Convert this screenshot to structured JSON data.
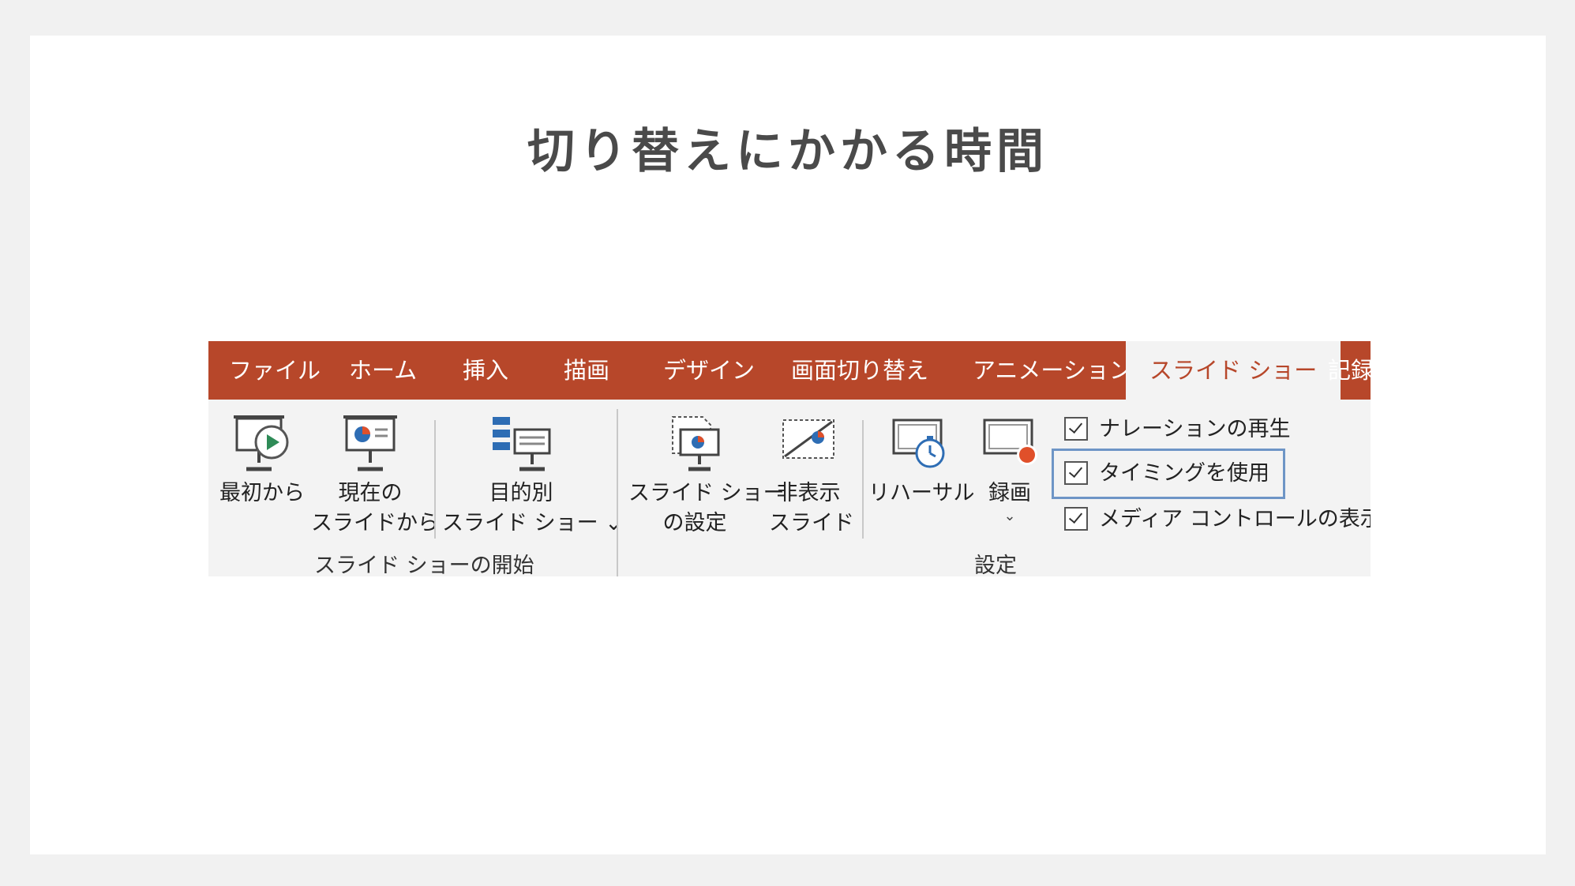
{
  "slide": {
    "title": "切り替えにかかる時間"
  },
  "ribbon": {
    "tabs": [
      {
        "label": "ファイル"
      },
      {
        "label": "ホーム"
      },
      {
        "label": "挿入"
      },
      {
        "label": "描画"
      },
      {
        "label": "デザイン"
      },
      {
        "label": "画面切り替え"
      },
      {
        "label": "アニメーション"
      },
      {
        "label": "スライド ショー"
      },
      {
        "label": "記録"
      }
    ],
    "active_tab": "スライド ショー",
    "groups": {
      "start": {
        "label": "スライド ショーの開始",
        "buttons": {
          "from_beginning": {
            "line1": "最初から"
          },
          "from_current": {
            "line1": "現在の",
            "line2": "スライドから"
          },
          "custom": {
            "line1": "目的別",
            "line2": "スライド ショー ⌄"
          }
        }
      },
      "setup": {
        "label": "設定",
        "buttons": {
          "setup_show": {
            "line1": "スライド ショー",
            "line2": "の設定"
          },
          "hide_slide": {
            "line1": "非表示",
            "line2": "スライド"
          },
          "rehearse": {
            "line1": "リハーサル"
          },
          "record": {
            "line1": "録画",
            "line2": "⌄"
          }
        },
        "checkboxes": [
          {
            "label": "ナレーションの再生",
            "checked": true
          },
          {
            "label": "タイミングを使用",
            "checked": true,
            "highlighted": true
          },
          {
            "label": "メディア コントロールの表示",
            "checked": true
          }
        ]
      }
    },
    "colors": {
      "tab_bar": "#b7472a",
      "ribbon_bg": "#f3f3f3",
      "highlight_border": "#6e95c6",
      "record_dot": "#e0502a"
    }
  }
}
